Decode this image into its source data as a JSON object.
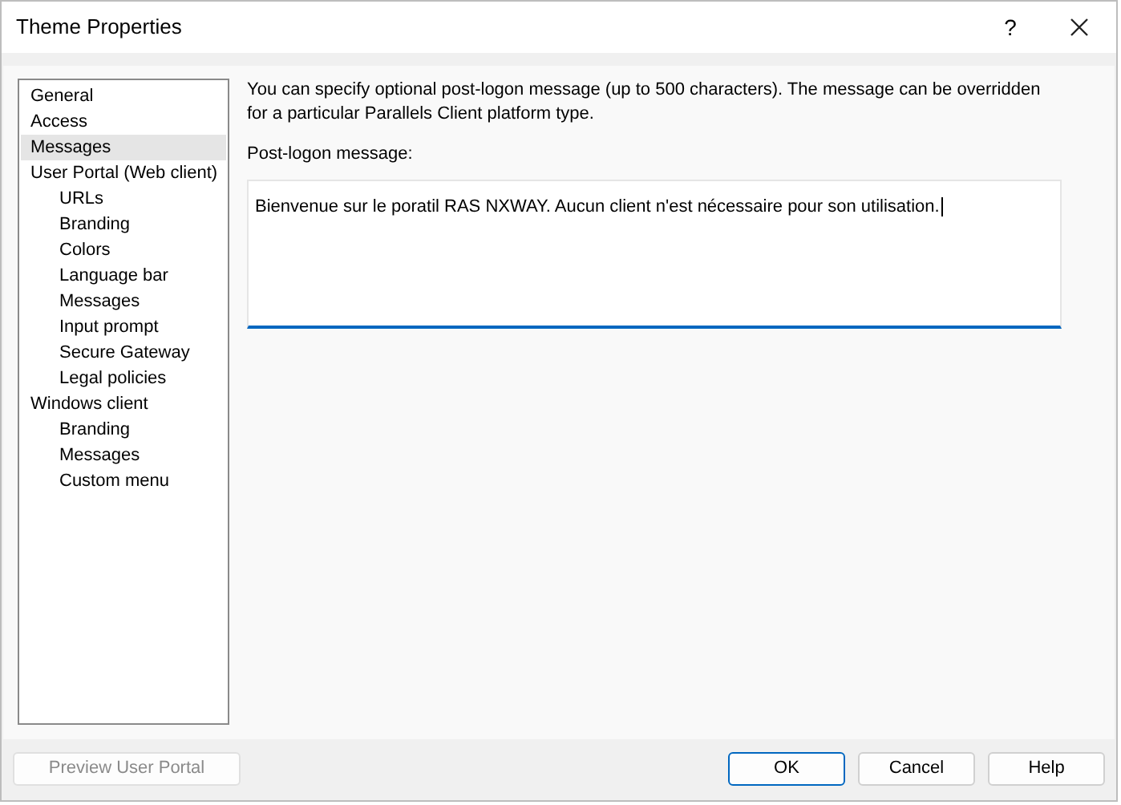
{
  "window": {
    "title": "Theme Properties",
    "help_button": "?"
  },
  "sidebar": {
    "items": [
      {
        "label": "General",
        "selected": false
      },
      {
        "label": "Access",
        "selected": false
      },
      {
        "label": "Messages",
        "selected": true
      },
      {
        "label": "User Portal (Web client)",
        "selected": false,
        "children": [
          {
            "label": "URLs",
            "selected": false
          },
          {
            "label": "Branding",
            "selected": false
          },
          {
            "label": "Colors",
            "selected": false
          },
          {
            "label": "Language bar",
            "selected": false
          },
          {
            "label": "Messages",
            "selected": false
          },
          {
            "label": "Input prompt",
            "selected": false
          },
          {
            "label": "Secure Gateway",
            "selected": false
          },
          {
            "label": "Legal policies",
            "selected": false
          }
        ]
      },
      {
        "label": "Windows client",
        "selected": false,
        "children": [
          {
            "label": "Branding",
            "selected": false
          },
          {
            "label": "Messages",
            "selected": false
          },
          {
            "label": "Custom menu",
            "selected": false
          }
        ]
      }
    ]
  },
  "description": "You can specify optional post-logon message (up to 500 characters). The message can be overridden for a particular Parallels Client platform type.",
  "message_field": {
    "label": "Post-logon message:",
    "value": "Bienvenue sur le poratil RAS NXWAY. Aucun client n'est nécessaire pour son utilisation."
  },
  "buttons": [
    {
      "label": "Preview User Portal",
      "kind": "secondary",
      "disabled": true
    },
    {
      "label": "OK",
      "kind": "default",
      "disabled": false
    },
    {
      "label": "Cancel",
      "kind": "normal",
      "disabled": false
    },
    {
      "label": "Help",
      "kind": "normal",
      "disabled": false
    }
  ]
}
